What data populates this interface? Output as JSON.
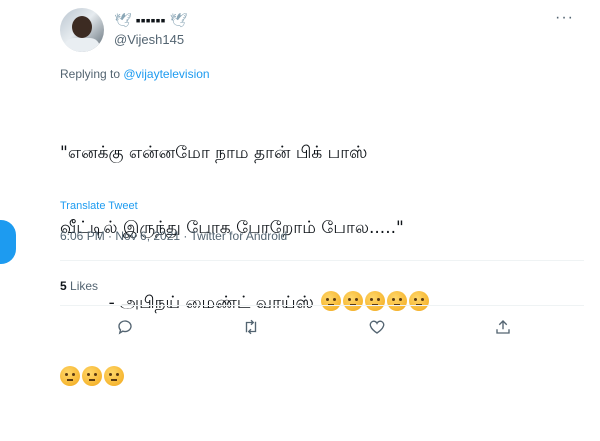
{
  "tweet": {
    "display_name": "▪▪▪▪▪▪",
    "handle": "@Vijesh145",
    "replying_prefix": "Replying to ",
    "replying_handle": "@vijaytelevision",
    "text_lines": [
      "\"எனக்கு என்னமோ நாம தான் பிக் பாஸ்",
      "வீட்டில் இருந்து போக போறோம் போல.....\"",
      "         - அபிநய் மைண்ட் வாய்ஸ் "
    ],
    "translate_label": "Translate Tweet",
    "meta": "6:06 PM · Nov 6, 2021 · Twitter for Android",
    "likes_count": "5",
    "likes_label": "Likes"
  },
  "icons": {
    "reply": "reply-icon",
    "retweet": "retweet-icon",
    "like": "heart-icon",
    "share": "share-icon",
    "more": "more-icon",
    "emoji": "thinking-face-emoji"
  },
  "colors": {
    "accent": "#1d9bf0",
    "secondary_text": "#536471",
    "primary_text": "#0f1419"
  }
}
